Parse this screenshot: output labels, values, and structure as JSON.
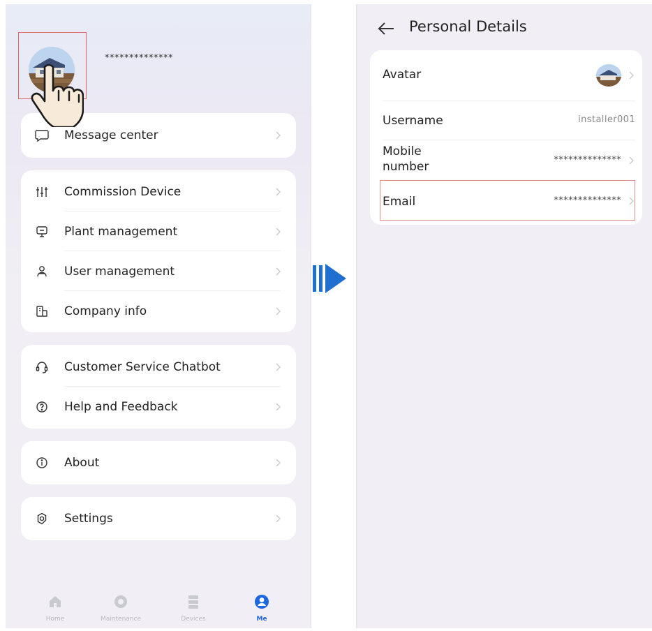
{
  "left_screen": {
    "profile": {
      "masked_name": "**************"
    },
    "cards": [
      {
        "items": [
          {
            "label": "Message center",
            "icon": "message-icon"
          }
        ]
      },
      {
        "items": [
          {
            "label": "Commission Device",
            "icon": "sliders-icon"
          },
          {
            "label": "Plant management",
            "icon": "monitor-icon"
          },
          {
            "label": "User management",
            "icon": "users-icon"
          },
          {
            "label": "Company info",
            "icon": "building-icon"
          }
        ]
      },
      {
        "items": [
          {
            "label": "Customer Service Chatbot",
            "icon": "headset-icon"
          },
          {
            "label": "Help and Feedback",
            "icon": "help-icon"
          }
        ]
      },
      {
        "items": [
          {
            "label": "About",
            "icon": "info-icon"
          }
        ]
      },
      {
        "items": [
          {
            "label": "Settings",
            "icon": "gear-icon"
          }
        ]
      }
    ],
    "tabbar": [
      {
        "label": "Home",
        "icon": "home-icon"
      },
      {
        "label": "Maintenance",
        "icon": "maintenance-icon"
      },
      {
        "label": "Devices",
        "icon": "devices-icon"
      },
      {
        "label": "Me",
        "icon": "me-icon",
        "active": true
      }
    ]
  },
  "right_screen": {
    "title": "Personal Details",
    "rows": [
      {
        "label": "Avatar",
        "value": ""
      },
      {
        "label": "Username",
        "value": "installer001"
      },
      {
        "label": "Mobile number",
        "value": "**************"
      },
      {
        "label": "Email",
        "value": "**************"
      }
    ]
  },
  "colors": {
    "accent": "#1d66e0",
    "arrow": "#1f6fd1",
    "highlight": "#e06a6a"
  }
}
